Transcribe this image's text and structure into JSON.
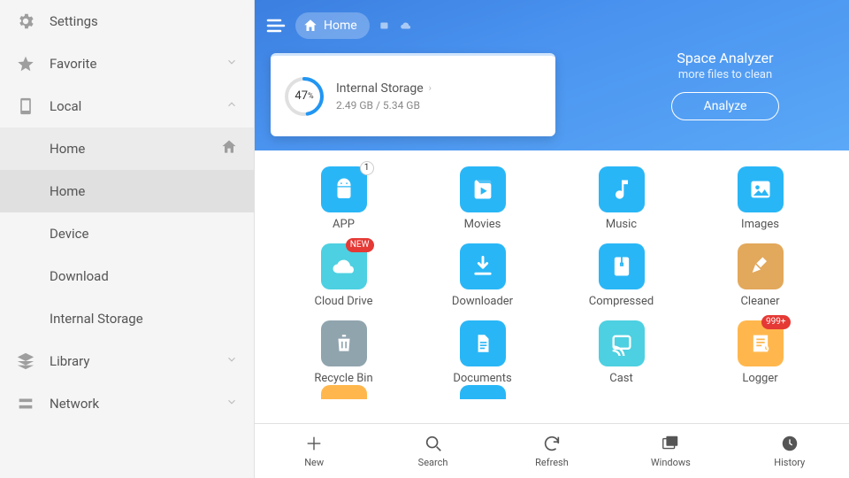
{
  "sidebar": {
    "settings": "Settings",
    "favorite": "Favorite",
    "local": "Local",
    "local_items": [
      "Home",
      "Home",
      "Device",
      "Download",
      "Internal Storage"
    ],
    "library": "Library",
    "network": "Network"
  },
  "breadcrumb": {
    "label": "Home"
  },
  "storage": {
    "percent": "47",
    "percent_suffix": "%",
    "title": "Internal Storage",
    "size": "2.49 GB / 5.34 GB"
  },
  "analyzer": {
    "title": "Space Analyzer",
    "subtitle": "more files to clean",
    "button": "Analyze"
  },
  "tiles": [
    {
      "label": "APP",
      "color": "#29b6f6",
      "icon": "android",
      "badge": "1",
      "badgeStyle": "circ"
    },
    {
      "label": "Movies",
      "color": "#29b6f6",
      "icon": "play"
    },
    {
      "label": "Music",
      "color": "#29b6f6",
      "icon": "note"
    },
    {
      "label": "Images",
      "color": "#29b6f6",
      "icon": "image"
    },
    {
      "label": "Cloud Drive",
      "color": "#4dd0e1",
      "icon": "cloud",
      "badge": "NEW"
    },
    {
      "label": "Downloader",
      "color": "#29b6f6",
      "icon": "download"
    },
    {
      "label": "Compressed",
      "color": "#29b6f6",
      "icon": "zip"
    },
    {
      "label": "Cleaner",
      "color": "#e2a85b",
      "icon": "broom"
    },
    {
      "label": "Recycle Bin",
      "color": "#90a4ae",
      "icon": "trash"
    },
    {
      "label": "Documents",
      "color": "#29b6f6",
      "icon": "doc"
    },
    {
      "label": "Cast",
      "color": "#4dd0e1",
      "icon": "cast"
    },
    {
      "label": "Logger",
      "color": "#ffb74d",
      "icon": "log",
      "badge": "999+"
    }
  ],
  "bottom": [
    {
      "label": "New",
      "icon": "plus"
    },
    {
      "label": "Search",
      "icon": "search"
    },
    {
      "label": "Refresh",
      "icon": "refresh"
    },
    {
      "label": "Windows",
      "icon": "windows"
    },
    {
      "label": "History",
      "icon": "clock"
    }
  ]
}
